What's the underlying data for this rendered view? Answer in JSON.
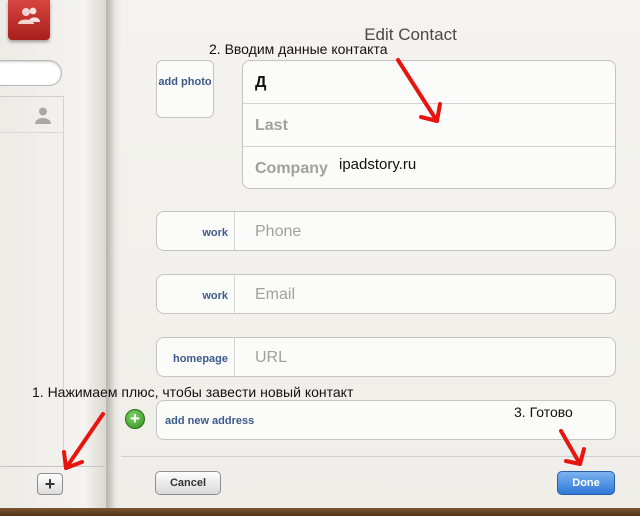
{
  "left_panel": {
    "add_button_label": "+"
  },
  "editor": {
    "title": "Edit Contact",
    "photo_label": "add photo",
    "first_name_value": "Д",
    "last_placeholder": "Last",
    "company_placeholder": "Company",
    "fields": [
      {
        "label": "work",
        "placeholder": "Phone"
      },
      {
        "label": "work",
        "placeholder": "Email"
      },
      {
        "label": "homepage",
        "placeholder": "URL"
      }
    ],
    "add_address_label": "add new address",
    "cancel_label": "Cancel",
    "done_label": "Done"
  },
  "annotations": {
    "step2": "2. Вводим данные контакта",
    "site": "ipadstory.ru",
    "step1": "1. Нажимаем плюс, чтобы завести новый контакт",
    "step3": "3. Готово",
    "arrow_color": "#e8140f"
  },
  "colors": {
    "label_blue": "#3c5a8a",
    "ribbon_red": "#c0302b",
    "done_blue": "#2f78d6"
  },
  "icons": {
    "ribbon": "contacts-people-icon",
    "list_avatar": "person-silhouette-icon",
    "add_address": "green-plus-circle-icon"
  }
}
